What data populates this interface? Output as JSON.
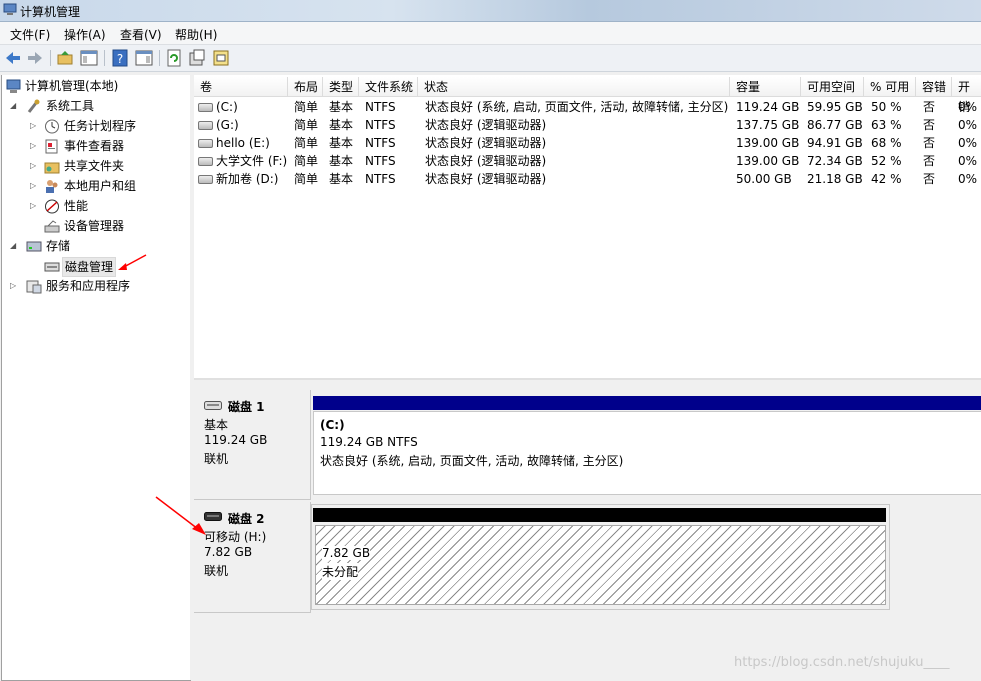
{
  "window": {
    "title": "计算机管理"
  },
  "menu": [
    "文件(F)",
    "操作(A)",
    "查看(V)",
    "帮助(H)"
  ],
  "toolbar_icons": [
    "back-arrow-icon",
    "forward-arrow-icon",
    "up-folder-icon",
    "show-tree-icon",
    "help-icon",
    "action-pane-icon",
    "refresh-icon",
    "properties-icon",
    "export-icon"
  ],
  "tree": {
    "root": "计算机管理(本地)",
    "system_tools": "系统工具",
    "task_scheduler": "任务计划程序",
    "event_viewer": "事件查看器",
    "shared_folders": "共享文件夹",
    "local_users": "本地用户和组",
    "performance": "性能",
    "device_manager": "设备管理器",
    "storage": "存储",
    "disk_management": "磁盘管理",
    "services": "服务和应用程序"
  },
  "table": {
    "headers": [
      "卷",
      "布局",
      "类型",
      "文件系统",
      "状态",
      "容量",
      "可用空间",
      "% 可用",
      "容错",
      "开销"
    ],
    "rows": [
      {
        "name": "(C:)",
        "layout": "简单",
        "type": "基本",
        "fs": "NTFS",
        "status": "状态良好 (系统, 启动, 页面文件, 活动, 故障转储, 主分区)",
        "capacity": "119.24 GB",
        "free": "59.95 GB",
        "pct": "50 %",
        "fault": "否",
        "overhead": "0%"
      },
      {
        "name": "(G:)",
        "layout": "简单",
        "type": "基本",
        "fs": "NTFS",
        "status": "状态良好 (逻辑驱动器)",
        "capacity": "137.75 GB",
        "free": "86.77 GB",
        "pct": "63 %",
        "fault": "否",
        "overhead": "0%"
      },
      {
        "name": "hello (E:)",
        "layout": "简单",
        "type": "基本",
        "fs": "NTFS",
        "status": "状态良好 (逻辑驱动器)",
        "capacity": "139.00 GB",
        "free": "94.91 GB",
        "pct": "68 %",
        "fault": "否",
        "overhead": "0%"
      },
      {
        "name": "大学文件 (F:)",
        "layout": "简单",
        "type": "基本",
        "fs": "NTFS",
        "status": "状态良好 (逻辑驱动器)",
        "capacity": "139.00 GB",
        "free": "72.34 GB",
        "pct": "52 %",
        "fault": "否",
        "overhead": "0%"
      },
      {
        "name": "新加卷 (D:)",
        "layout": "简单",
        "type": "基本",
        "fs": "NTFS",
        "status": "状态良好 (逻辑驱动器)",
        "capacity": "50.00 GB",
        "free": "21.18 GB",
        "pct": "42 %",
        "fault": "否",
        "overhead": "0%"
      }
    ]
  },
  "disk1": {
    "name": "磁盘 1",
    "type": "基本",
    "size": "119.24 GB",
    "state": "联机",
    "partition": {
      "label": "(C:)",
      "size_fs": "119.24 GB NTFS",
      "status": "状态良好 (系统, 启动, 页面文件, 活动, 故障转储, 主分区)"
    },
    "bar_color": "#00008b"
  },
  "disk2": {
    "name": "磁盘 2",
    "type": "可移动 (H:)",
    "size": "7.82 GB",
    "state": "联机",
    "partition": {
      "size": "7.82 GB",
      "status": "未分配"
    },
    "bar_color": "#000000"
  },
  "watermark": "https://blog.csdn.net/shujuku____",
  "accent": "#ff0000"
}
